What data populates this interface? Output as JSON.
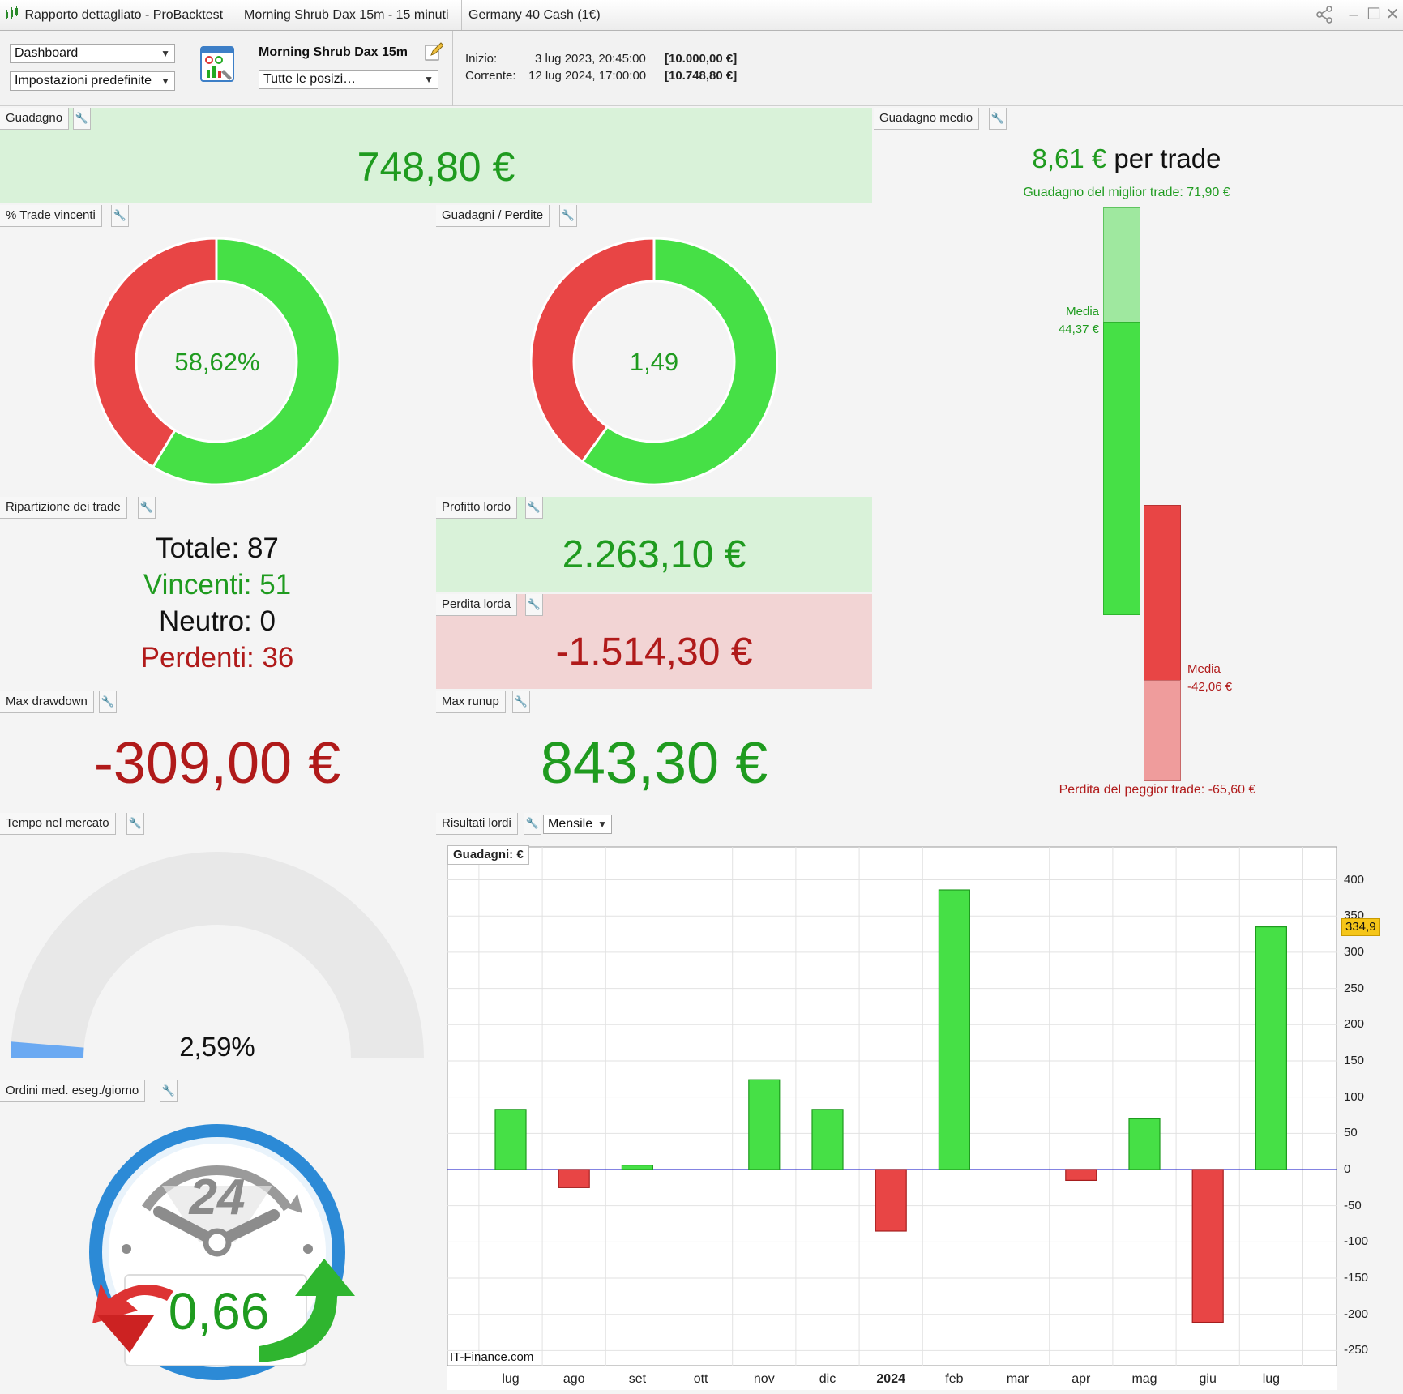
{
  "window": {
    "title": "Rapporto dettagliato - ProBacktest",
    "strategy_tab": "Morning Shrub Dax 15m - 15 minuti",
    "instrument_tab": "Germany 40 Cash (1€)"
  },
  "toolbar": {
    "view_select": "Dashboard",
    "settings_select": "Impostazioni predefinite",
    "system_name": "Morning Shrub Dax 15m",
    "positions_select": "Tutte le posizi…",
    "start_label": "Inizio:",
    "start_date": "3 lug 2023, 20:45:00",
    "start_capital": "[10.000,00 €]",
    "current_label": "Corrente:",
    "current_date": "12 lug 2024, 17:00:00",
    "current_capital": "[10.748,80 €]"
  },
  "panels": {
    "gain": {
      "title": "Guadagno",
      "value": "748,80 €"
    },
    "win_pct": {
      "title": "% Trade vincenti",
      "value": "58,62%",
      "fraction": 0.5862
    },
    "gain_loss": {
      "title": "Guadagni / Perdite",
      "value": "1,49",
      "fraction": 0.599
    },
    "avg_gain": {
      "title": "Guadagno medio",
      "value": "8,61 €",
      "suffix": "per trade",
      "best_trade": "Guadagno del miglior trade: 71,90 €",
      "avg_win_label": "Media",
      "avg_win_value": "44,37 €",
      "avg_loss_label": "Media",
      "avg_loss_value": "-42,06 €",
      "worst_trade": "Perdita del peggior trade: -65,60 €",
      "best": 71.9,
      "avg_win": 44.37,
      "avg_loss": -42.06,
      "worst": -65.6
    },
    "breakdown": {
      "title": "Ripartizione dei trade",
      "total_label": "Totale:",
      "total": "87",
      "win_label": "Vincenti:",
      "win": "51",
      "neutral_label": "Neutro:",
      "neutral": "0",
      "loss_label": "Perdenti:",
      "loss": "36"
    },
    "gross_profit": {
      "title": "Profitto lordo",
      "value": "2.263,10 €"
    },
    "gross_loss": {
      "title": "Perdita lorda",
      "value": "-1.514,30 €"
    },
    "max_drawdown": {
      "title": "Max drawdown",
      "value": "-309,00 €"
    },
    "max_runup": {
      "title": "Max runup",
      "value": "843,30 €"
    },
    "time_in_market": {
      "title": "Tempo nel mercato",
      "value": "2,59%",
      "fraction": 0.0259
    },
    "orders_per_day": {
      "title": "Ordini med. eseg./giorno",
      "value": "0,66",
      "clock_label": "24"
    },
    "gross_results": {
      "title": "Risultati lordi",
      "period_select": "Mensile",
      "chart_title": "Guadagni: €",
      "watermark": "IT-Finance.com",
      "last_value_tag": "334,9"
    }
  },
  "chart_data": {
    "type": "bar",
    "title": "Guadagni: €",
    "categories": [
      "lug",
      "ago",
      "set",
      "ott",
      "nov",
      "dic",
      "2024",
      "feb",
      "mar",
      "apr",
      "mag",
      "giu",
      "lug"
    ],
    "values": [
      83,
      -25,
      6,
      0,
      124,
      83,
      -85,
      386,
      0,
      -15,
      70,
      -211,
      335
    ],
    "y_ticks": [
      "400",
      "350",
      "300",
      "250",
      "200",
      "150",
      "100",
      "50",
      "0",
      "-50",
      "-100",
      "-150",
      "-200",
      "-250"
    ],
    "ylim": [
      -270,
      420
    ],
    "grid": true,
    "colors": {
      "positive": "#46e046",
      "negative": "#e84545"
    }
  }
}
